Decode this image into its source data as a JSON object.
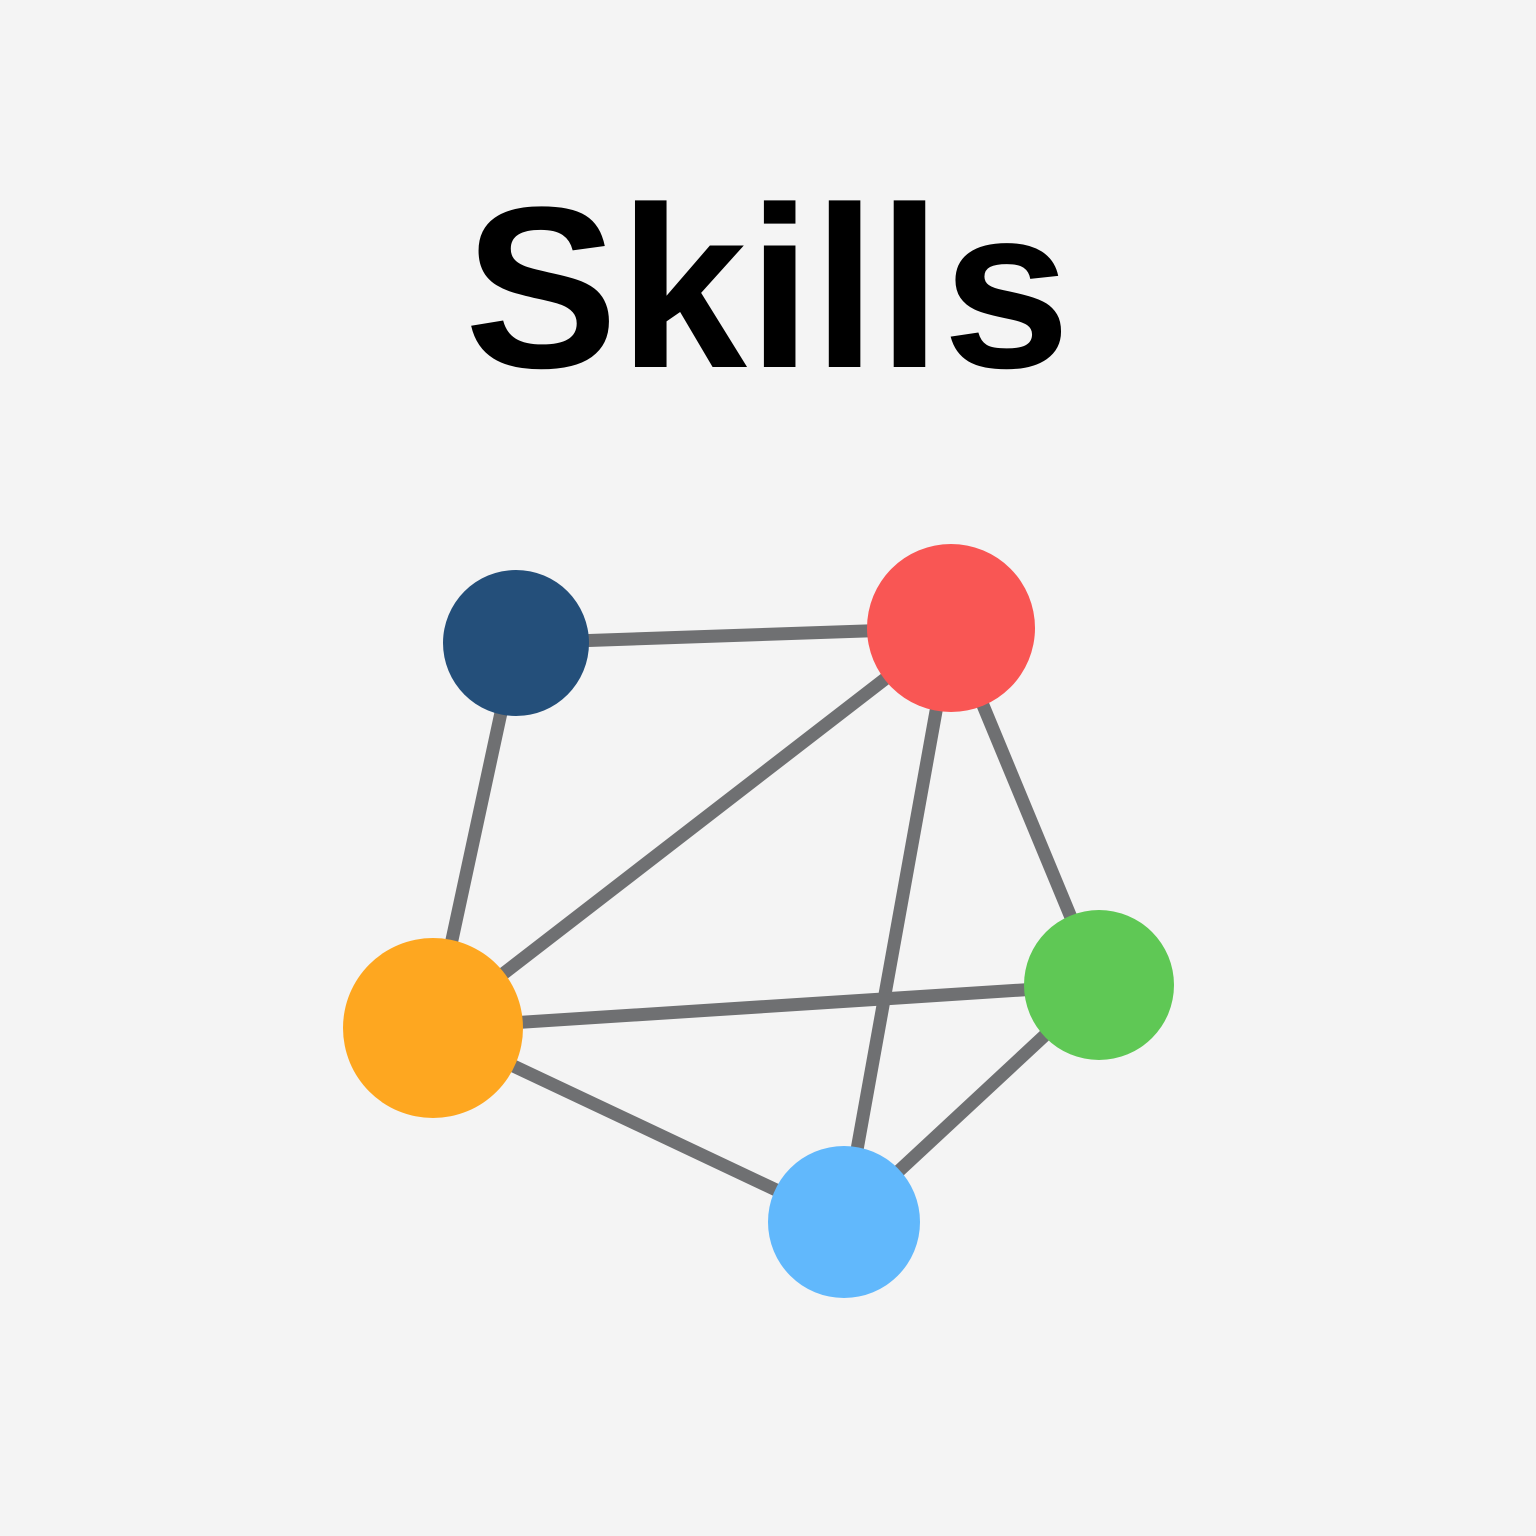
{
  "title": "Skills",
  "colors": {
    "background": "#f4f4f4",
    "edge": "#6f7072",
    "title": "#000000"
  },
  "graph": {
    "nodes": [
      {
        "id": "navy",
        "color": "#244f7a"
      },
      {
        "id": "red",
        "color": "#f95654"
      },
      {
        "id": "orange",
        "color": "#fea720"
      },
      {
        "id": "green",
        "color": "#5fc855"
      },
      {
        "id": "blue",
        "color": "#61b8fc"
      }
    ],
    "edges": [
      [
        "navy",
        "red"
      ],
      [
        "navy",
        "orange"
      ],
      [
        "red",
        "orange"
      ],
      [
        "red",
        "blue"
      ],
      [
        "red",
        "green"
      ],
      [
        "orange",
        "green"
      ],
      [
        "orange",
        "blue"
      ],
      [
        "green",
        "blue"
      ]
    ]
  }
}
